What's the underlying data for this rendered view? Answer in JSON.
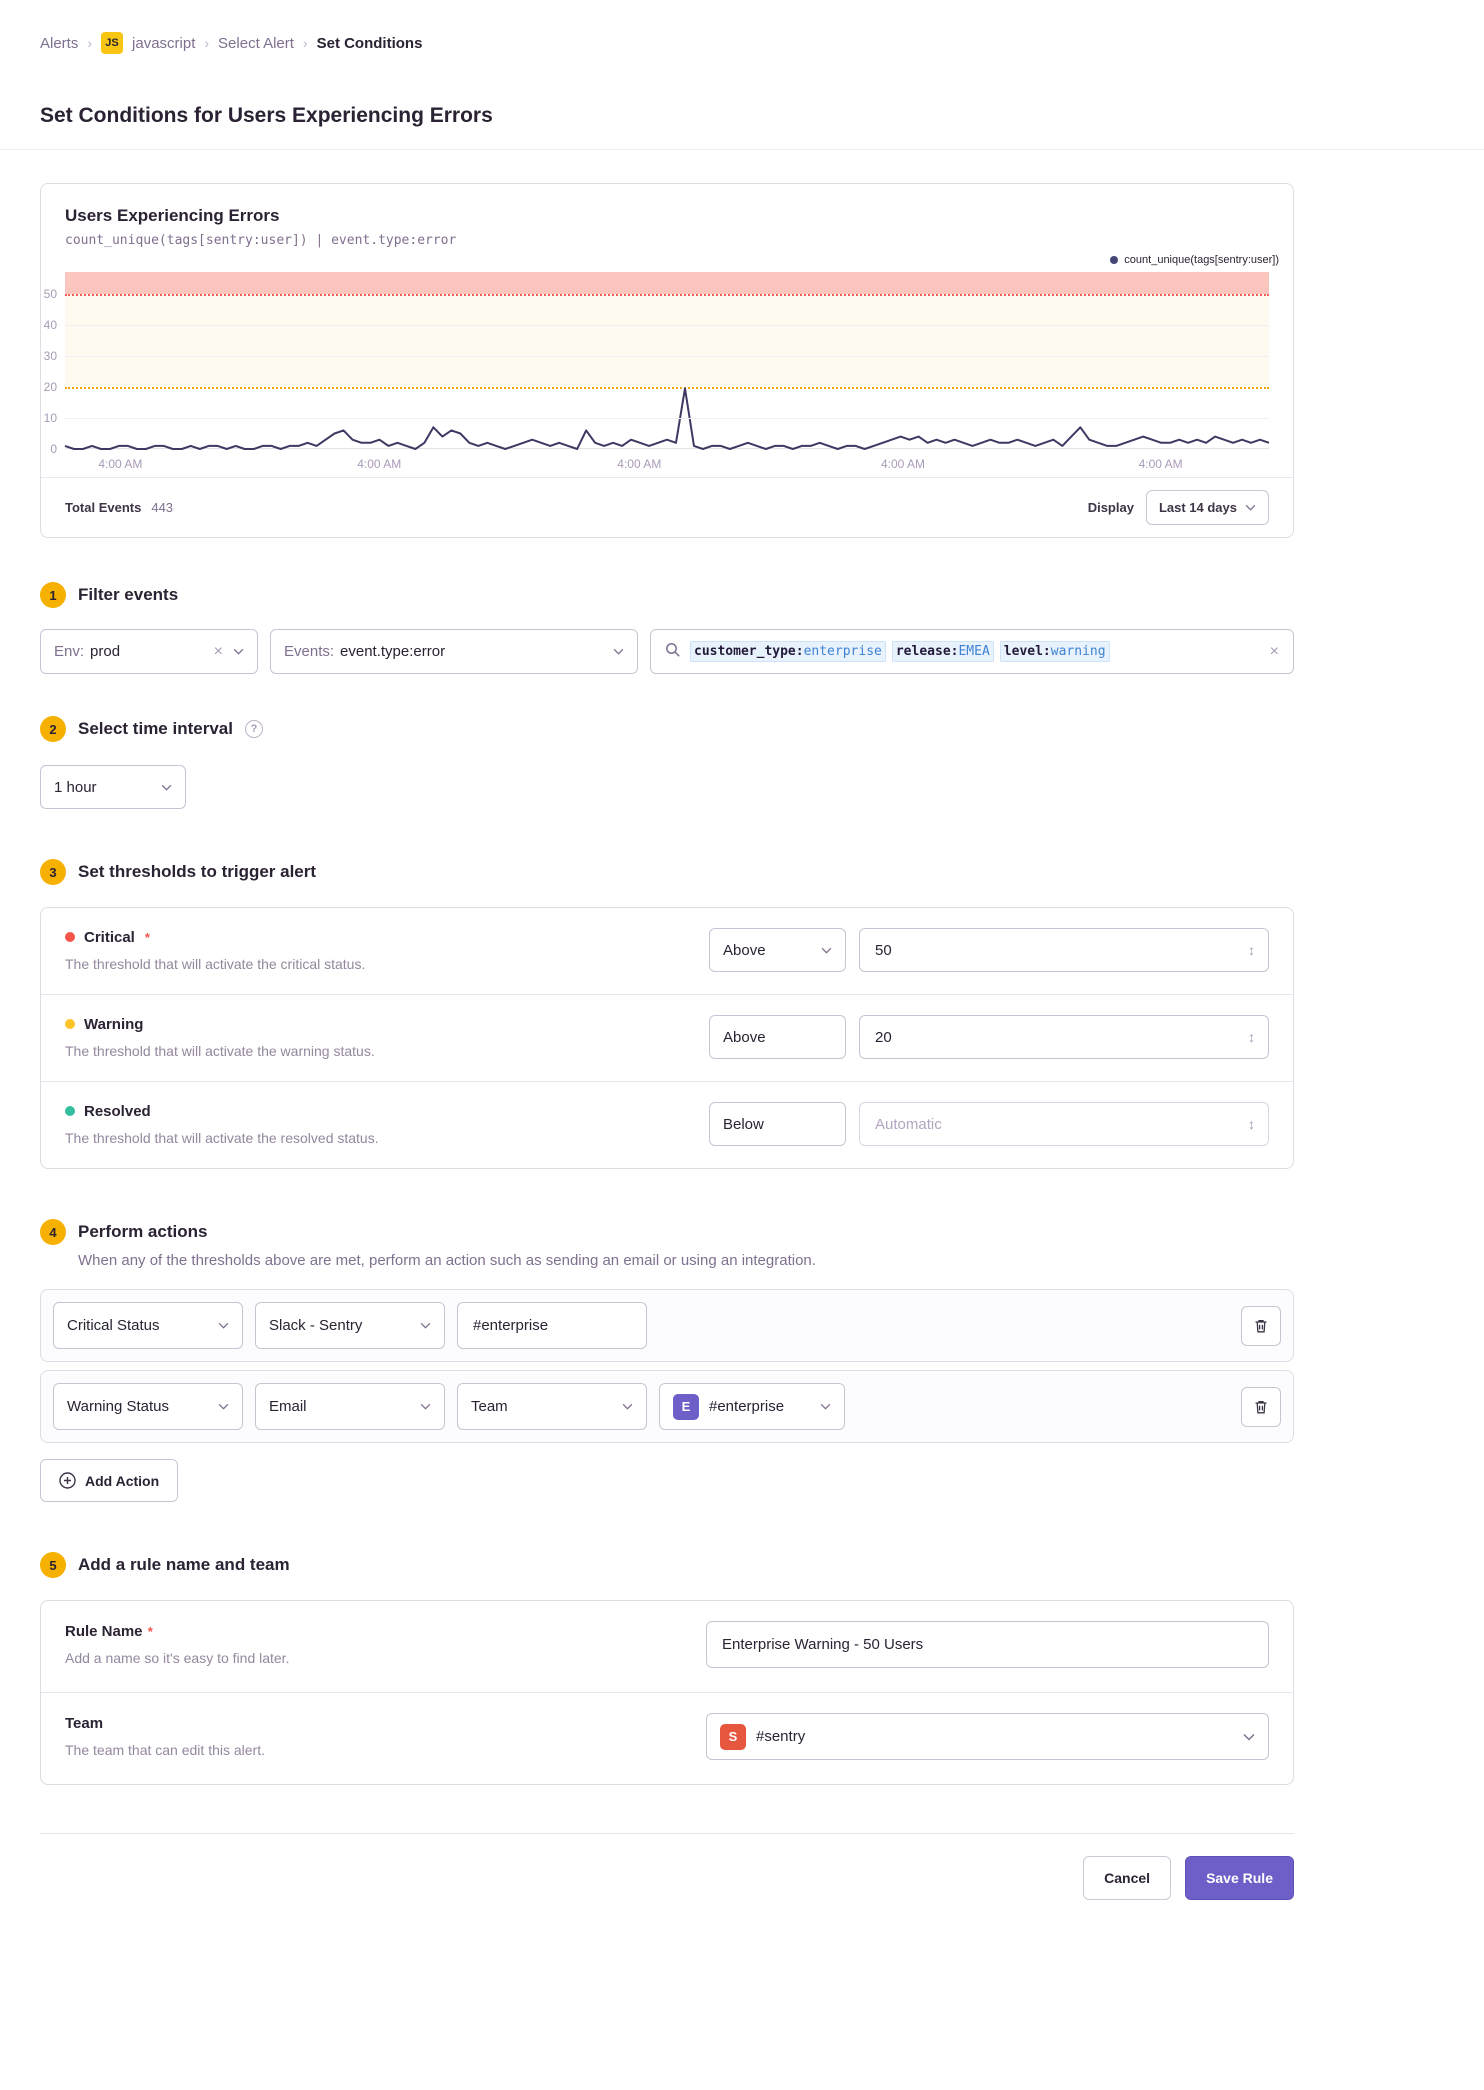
{
  "icons": {
    "close": "×",
    "stepper": "↕",
    "separator": "›",
    "help": "?",
    "search_clear": "×"
  },
  "breadcrumb": {
    "items": [
      {
        "label": "Alerts"
      },
      {
        "label": "javascript",
        "badge": "JS"
      },
      {
        "label": "Select Alert"
      },
      {
        "label": "Set Conditions"
      }
    ]
  },
  "page": {
    "title": "Set Conditions for Users Experiencing Errors"
  },
  "chart": {
    "total_label": "Total Events",
    "total_value": "443",
    "display_label": "Display",
    "range_value": "Last 14 days"
  },
  "chart_data": {
    "type": "line",
    "title": "Users Experiencing Errors",
    "query": "count_unique(tags[sentry:user]) | event.type:error",
    "legend_position": "top-right",
    "series": [
      {
        "name": "count_unique(tags[sentry:user])",
        "color": "#3f3862",
        "values": [
          1,
          0,
          0,
          1,
          0,
          0,
          1,
          1,
          0,
          0,
          1,
          1,
          0,
          0,
          1,
          0,
          1,
          1,
          0,
          1,
          0,
          0,
          1,
          1,
          0,
          1,
          1,
          2,
          1,
          3,
          5,
          6,
          3,
          2,
          2,
          3,
          1,
          2,
          1,
          0,
          2,
          7,
          4,
          6,
          5,
          2,
          1,
          2,
          1,
          0,
          1,
          2,
          3,
          2,
          1,
          2,
          1,
          0,
          6,
          2,
          1,
          2,
          1,
          3,
          2,
          1,
          2,
          3,
          2,
          19.5,
          1,
          0,
          1,
          1,
          0,
          1,
          2,
          1,
          0,
          1,
          1,
          0,
          1,
          1,
          2,
          1,
          0,
          1,
          1,
          0,
          1,
          2,
          3,
          4,
          3,
          4,
          2,
          3,
          2,
          3,
          2,
          1,
          2,
          3,
          2,
          2,
          3,
          2,
          1,
          2,
          3,
          1,
          4,
          7,
          3,
          2,
          1,
          1,
          2,
          3,
          4,
          3,
          2,
          2,
          3,
          2,
          3,
          2,
          4,
          3,
          2,
          3,
          2,
          3,
          2
        ]
      }
    ],
    "x_labels": [
      "4:00 AM",
      "4:00 AM",
      "4:00 AM",
      "4:00 AM",
      "4:00 AM"
    ],
    "x_label_positions_pct": [
      4.6,
      26.1,
      47.7,
      69.6,
      91
    ],
    "y_ticks": [
      0,
      10,
      20,
      30,
      40,
      50
    ],
    "ylim": [
      0,
      57
    ],
    "grid": true,
    "thresholds": {
      "critical": 50,
      "warning": 20
    },
    "threshold_line_colors": {
      "critical": "#f3615b",
      "warning": "#f2a50c"
    },
    "threshold_band_colors": {
      "critical": "#fbc6be",
      "warning": "#fefaef"
    },
    "total_events": 443,
    "time_range": "Last 14 days"
  },
  "sections": {
    "filter": {
      "num": "1",
      "title": "Filter events",
      "env_label": "Env:",
      "env_value": "prod",
      "events_label": "Events:",
      "events_value": "event.type:error",
      "search_tokens": [
        {
          "key": "customer_type:",
          "value": "enterprise"
        },
        {
          "key": "release:",
          "value": "EMEA"
        },
        {
          "key": "level:",
          "value": "warning"
        }
      ]
    },
    "interval": {
      "num": "2",
      "title": "Select time interval",
      "value": "1 hour"
    },
    "thresholds": {
      "num": "3",
      "title": "Set thresholds to trigger alert",
      "rows": [
        {
          "name": "Critical",
          "required": "*",
          "desc": "The threshold that will activate the critical status.",
          "op": "Above",
          "value": "50",
          "dot_color": "#f55549"
        },
        {
          "name": "Warning",
          "desc": "The threshold that will activate the warning status.",
          "op": "Above",
          "value": "20",
          "dot_color": "#ffc227"
        },
        {
          "name": "Resolved",
          "desc": "The threshold that will activate the resolved status.",
          "op": "Below",
          "placeholder": "Automatic",
          "dot_color": "#33bf9e"
        }
      ]
    },
    "actions": {
      "num": "4",
      "title": "Perform actions",
      "desc": "When any of the thresholds above are met, perform an action such as sending an email or using an integration.",
      "rows": [
        {
          "status": "Critical Status",
          "integration": "Slack - Sentry",
          "target": "#enterprise"
        },
        {
          "status": "Warning Status",
          "integration": "Email",
          "target_type": "Team",
          "target": "#enterprise",
          "badge": "E",
          "badge_color": "#6c5fc7"
        }
      ],
      "add_label": "Add Action"
    },
    "rule": {
      "num": "5",
      "title": "Add a rule name and team",
      "name_label": "Rule Name",
      "name_required": "*",
      "name_desc": "Add a name so it's easy to find later.",
      "name_value": "Enterprise Warning - 50 Users",
      "team_label": "Team",
      "team_desc": "The team that can edit this alert.",
      "team_value": "#sentry",
      "team_badge": "S",
      "team_badge_color": "#e7563f"
    }
  },
  "footer": {
    "cancel_label": "Cancel",
    "save_label": "Save Rule"
  },
  "colors": {
    "accent_purple": "#6c5fc7",
    "step_circle_yellow": "#f5b000",
    "js_badge_yellow": "#f9c513",
    "critical_red": "#f55549",
    "warning_yellow": "#ffc227",
    "resolved_teal": "#33bf9e",
    "line_series": "#3f3862"
  }
}
